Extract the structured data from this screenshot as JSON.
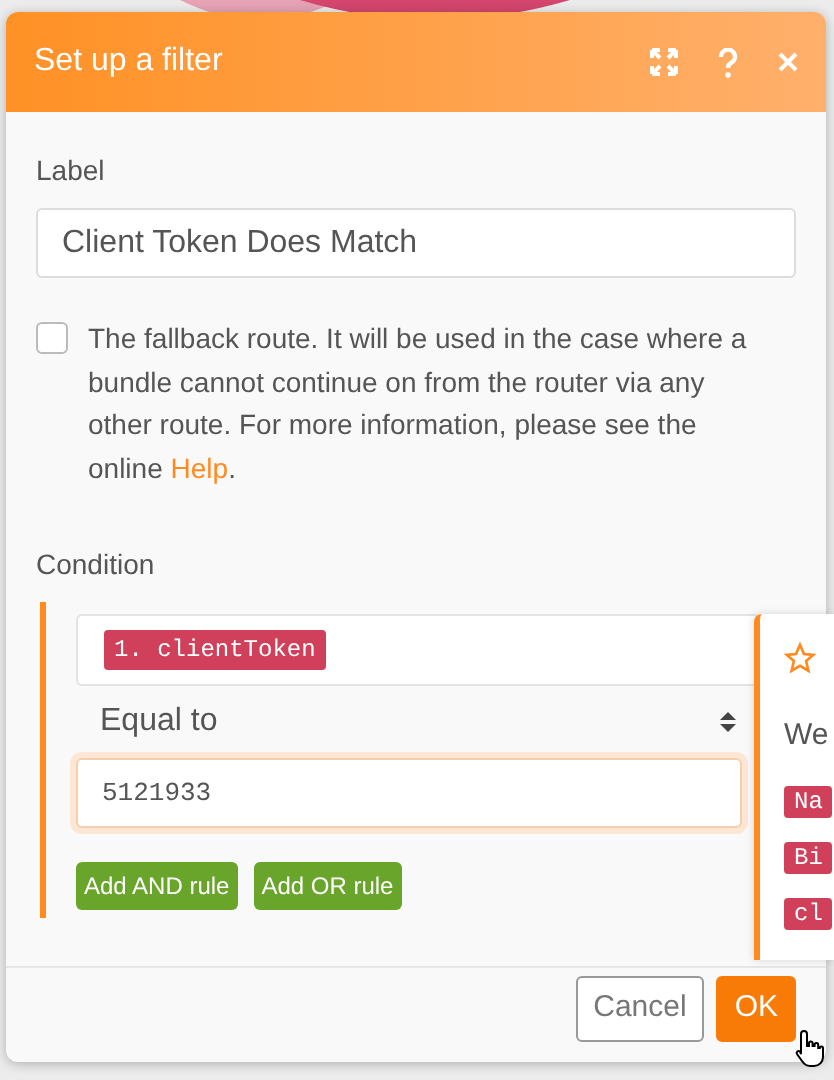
{
  "dialog": {
    "title": "Set up a filter",
    "label": {
      "caption": "Label",
      "value": "Client Token Does Match"
    },
    "fallback": {
      "checked": false,
      "text": "The fallback route. It will be used in the case where a bundle cannot continue on from the router via any other route. For more information, please see the online ",
      "link": "Help",
      "after": "."
    },
    "condition": {
      "caption": "Condition",
      "operand_tag": "1. clientToken",
      "operator": "Equal to",
      "value": "5121933",
      "buttons": [
        "Add AND rule",
        "Add OR rule"
      ]
    },
    "footer_buttons": [
      {
        "label": "Cancel",
        "kind": "secondary"
      },
      {
        "label": "OK",
        "kind": "primary"
      }
    ]
  },
  "side_panel": {
    "heading": "We",
    "tags": [
      "Na",
      "Bi",
      "cl"
    ]
  }
}
